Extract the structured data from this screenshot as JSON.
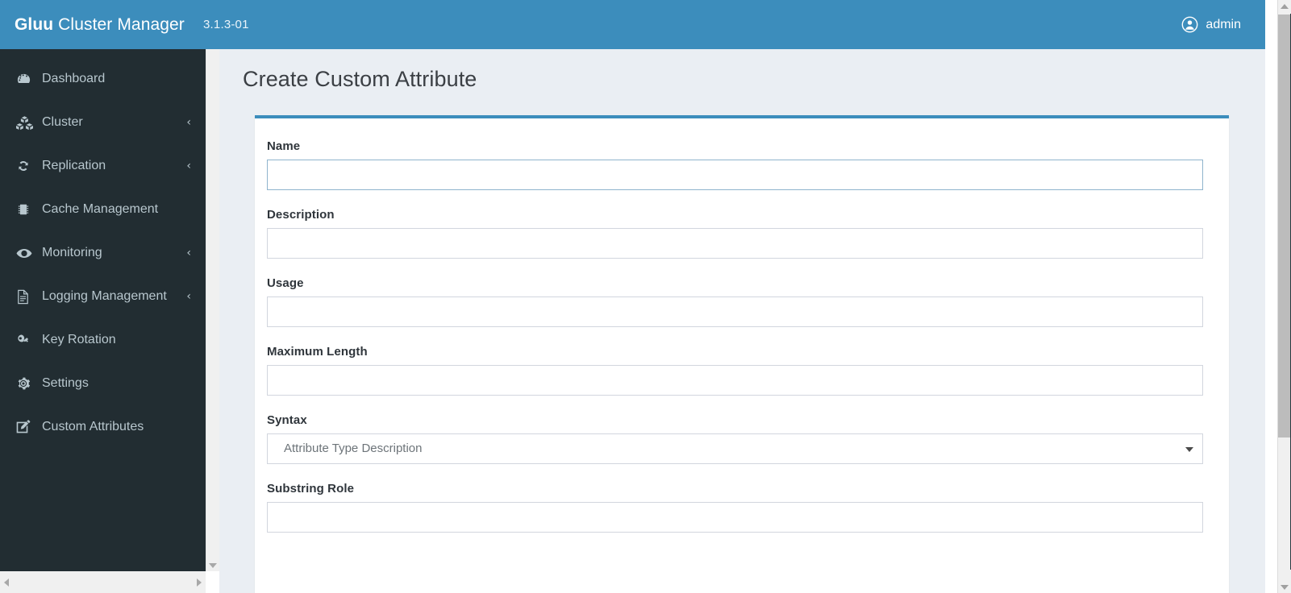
{
  "navbar": {
    "brand_bold": "Gluu",
    "brand_light": " Cluster Manager",
    "version": "3.1.3-01",
    "user_icon": "user-circle-icon",
    "user_name": "admin",
    "background_color": "#3c8dbc"
  },
  "sidebar": {
    "background_color": "#222d32",
    "text_color": "#b8c7ce",
    "items": [
      {
        "label": "Dashboard",
        "icon": "dashboard-icon",
        "has_chevron": false
      },
      {
        "label": "Cluster",
        "icon": "cubes-icon",
        "has_chevron": true,
        "chevron": "‹"
      },
      {
        "label": "Replication",
        "icon": "refresh-icon",
        "has_chevron": true,
        "chevron": "‹"
      },
      {
        "label": "Cache Management",
        "icon": "memory-chip-icon",
        "has_chevron": false
      },
      {
        "label": "Monitoring",
        "icon": "eye-icon",
        "has_chevron": true,
        "chevron": "‹"
      },
      {
        "label": "Logging Management",
        "icon": "file-text-icon",
        "has_chevron": true,
        "chevron": "‹"
      },
      {
        "label": "Key Rotation",
        "icon": "key-icon",
        "has_chevron": false
      },
      {
        "label": "Settings",
        "icon": "gear-icon",
        "has_chevron": false
      },
      {
        "label": "Custom Attributes",
        "icon": "pencil-square-icon",
        "has_chevron": false
      }
    ]
  },
  "main": {
    "page_title": "Create Custom Attribute",
    "card_accent_color": "#3c8dbc",
    "background_color": "#eaeef3",
    "fields": [
      {
        "label": "Name",
        "type": "text",
        "value": "",
        "placeholder": "",
        "focused": true
      },
      {
        "label": "Description",
        "type": "text",
        "value": "",
        "placeholder": "",
        "focused": false
      },
      {
        "label": "Usage",
        "type": "text",
        "value": "",
        "placeholder": "",
        "focused": false
      },
      {
        "label": "Maximum Length",
        "type": "text",
        "value": "",
        "placeholder": "",
        "focused": false
      },
      {
        "label": "Syntax",
        "type": "select",
        "value": "Attribute Type Description",
        "options": [
          "Attribute Type Description"
        ]
      },
      {
        "label": "Substring Role",
        "type": "text",
        "value": "",
        "placeholder": "",
        "focused": false
      }
    ]
  },
  "scrollbars": {
    "window_vertical": {
      "position": "right",
      "thumb_color": "#bcbcbc",
      "track_color": "#f0f0f0"
    },
    "sidebar_vertical": {
      "position": "left-of-content",
      "track_color": "#f0f0f0"
    },
    "sidebar_horizontal": {
      "position": "bottom-left",
      "track_color": "#f0f0f0"
    }
  }
}
